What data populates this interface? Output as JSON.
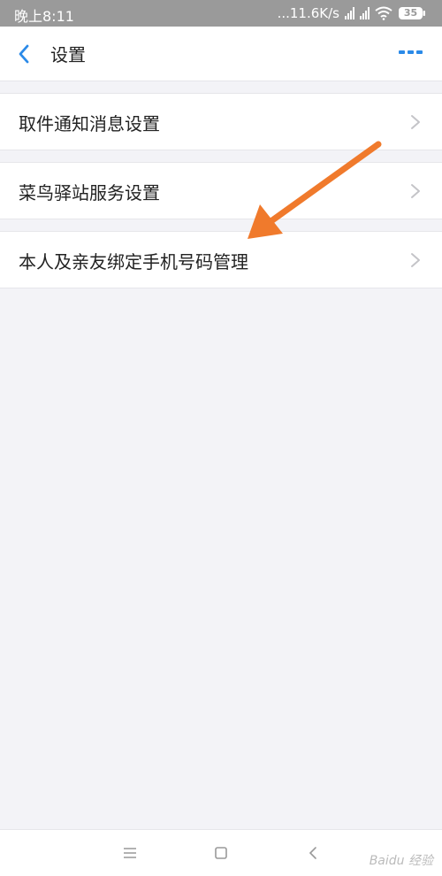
{
  "status_bar": {
    "time": "晚上8:11",
    "net_speed": "...11.6K/s",
    "battery": "35"
  },
  "nav": {
    "title": "设置"
  },
  "settings": [
    {
      "label": "取件通知消息设置"
    },
    {
      "label": "菜鸟驿站服务设置"
    },
    {
      "label": "本人及亲友绑定手机号码管理"
    }
  ],
  "watermark": "Baidu 经验",
  "colors": {
    "accent": "#2b8ae8",
    "annotation_arrow": "#f07a2c",
    "background": "#f3f3f7"
  }
}
